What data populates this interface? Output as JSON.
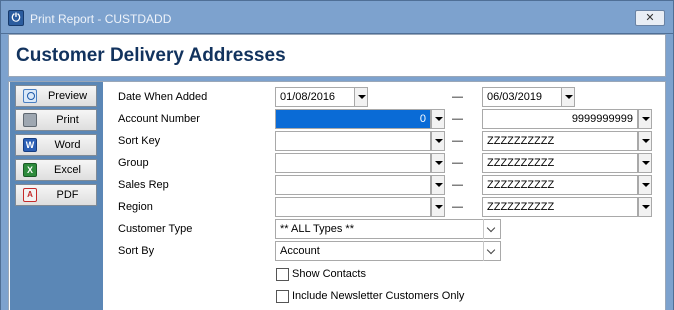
{
  "window": {
    "title": "Print Report - CUSTDADD",
    "close_symbol": "✕",
    "app_icon": "power-icon"
  },
  "header": {
    "title": "Customer Delivery Addresses"
  },
  "sidebar": {
    "buttons": [
      {
        "label": "Preview",
        "icon": "magnifier-icon"
      },
      {
        "label": "Print",
        "icon": "printer-icon"
      },
      {
        "label": "Word",
        "icon": "word-icon"
      },
      {
        "label": "Excel",
        "icon": "excel-icon"
      },
      {
        "label": "PDF",
        "icon": "pdf-icon"
      }
    ]
  },
  "form": {
    "date_when_added": {
      "label": "Date When Added",
      "from": "01/08/2016",
      "to": "06/03/2019"
    },
    "account_number": {
      "label": "Account Number",
      "from": "0",
      "to": "9999999999"
    },
    "sort_key": {
      "label": "Sort Key",
      "from": "",
      "to": "ZZZZZZZZZZ"
    },
    "group": {
      "label": "Group",
      "from": "",
      "to": "ZZZZZZZZZZ"
    },
    "sales_rep": {
      "label": "Sales Rep",
      "from": "",
      "to": "ZZZZZZZZZZ"
    },
    "region": {
      "label": "Region",
      "from": "",
      "to": "ZZZZZZZZZZ"
    },
    "customer_type": {
      "label": "Customer Type",
      "value": "** ALL Types **"
    },
    "sort_by": {
      "label": "Sort By",
      "value": "Account"
    },
    "range_separator": "—",
    "show_contacts": {
      "label": "Show Contacts",
      "checked": false
    },
    "include_newsletter": {
      "label": "Include Newsletter Customers Only",
      "checked": false
    }
  },
  "colors": {
    "title_blue": "#12335e",
    "frame": "#7da2ce",
    "sidebar": "#5b87b6",
    "selection": "#0a6bd6"
  }
}
